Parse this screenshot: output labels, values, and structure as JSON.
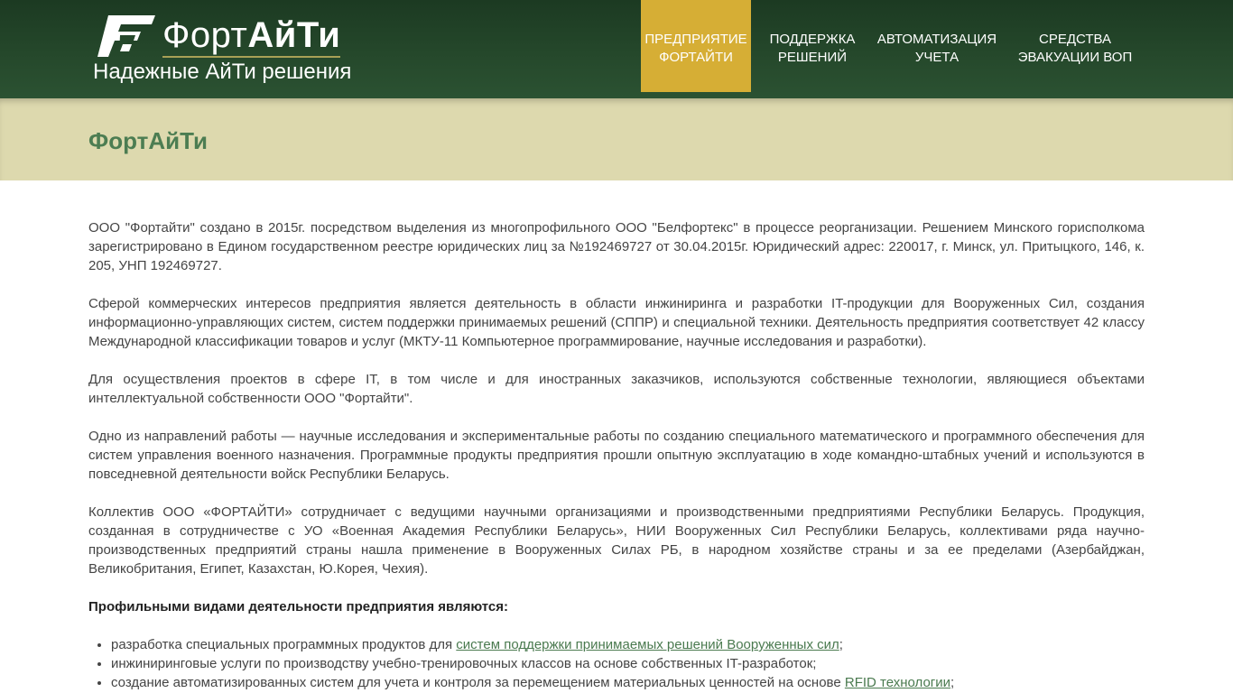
{
  "header": {
    "logo": {
      "light": "Форт",
      "bold": "АйТи"
    },
    "tagline": "Надежные АйТи решения",
    "nav": [
      {
        "line1": "Предприятие",
        "line2": "ФортАйТи",
        "active": true
      },
      {
        "line1": "Поддержка",
        "line2": "решений",
        "active": false
      },
      {
        "line1": "Автоматизация",
        "line2": "учета",
        "active": false
      },
      {
        "line1": "Средства",
        "line2": "эвакуации ВОП",
        "active": false
      }
    ]
  },
  "page": {
    "title": "ФортАйТи"
  },
  "content": {
    "paragraphs": [
      "ООО \"Фортайти\" создано в 2015г. посредством выделения из многопрофильного ООО \"Белфортекс\" в процессе реорганизации. Решением Минского горисполкома зарегистрировано в Едином государственном реестре юридических лиц за №192469727 от 30.04.2015г. Юридический адрес: 220017, г. Минск, ул. Притыцкого, 146, к. 205, УНП 192469727.",
      "Сферой коммерческих интересов предприятия является деятельность в области инжиниринга и разработки IT-продукции для Вооруженных Сил, создания информационно-управляющих систем, систем поддержки принимаемых решений (СППР) и специальной техники. Деятельность предприятия соответствует 42 классу Международной классификации товаров и услуг (МКТУ-11 Компьютерное программирование, научные исследования и разработки).",
      "Для осуществления проектов в сфере IT, в том числе и для иностранных заказчиков, используются собственные технологии, являющиеся объектами интеллектуальной собственности ООО \"Фортайти\".",
      "Одно из направлений работы — научные исследования и экспериментальные работы по созданию специального математического и программного обеспечения для систем управления военного назначения. Программные продукты предприятия прошли опытную эксплуатацию в ходе командно-штабных учений и используются в повседневной деятельности войск Республики Беларусь.",
      "Коллектив ООО «ФОРТАЙТИ» сотрудничает с ведущими научными организациями и производственными предприятиями Республики Беларусь. Продукция, созданная в сотрудничестве с УО «Военная Академия Республики Беларусь», НИИ Вооруженных Сил Республики Беларусь, коллективами ряда научно-производственных предприятий страны нашла применение в Вооруженных Силах РБ, в народном хозяйстве страны и за ее пределами (Азербайджан, Великобритания, Египет, Казахстан, Ю.Корея, Чехия)."
    ],
    "activities_heading": "Профильными видами деятельности предприятия являются:",
    "activities": [
      {
        "before": "разработка специальных программных продуктов для ",
        "link": "систем поддержки принимаемых решений Вооруженных сил",
        "after": ";"
      },
      {
        "before": "инжиниринговые услуги по производству учебно-тренировочных классов на основе собственных IT-разработок;",
        "link": "",
        "after": ""
      },
      {
        "before": "создание автоматизированных систем для учета и контроля за перемещением материальных ценностей на основе ",
        "link": "RFID технологии",
        "after": ";"
      }
    ]
  },
  "colors": {
    "header_green": "#25482b",
    "nav_active": "#d6ae35",
    "title_band": "#ddd9ae",
    "title_text": "#4c7d52",
    "link": "#4a7a4f"
  }
}
